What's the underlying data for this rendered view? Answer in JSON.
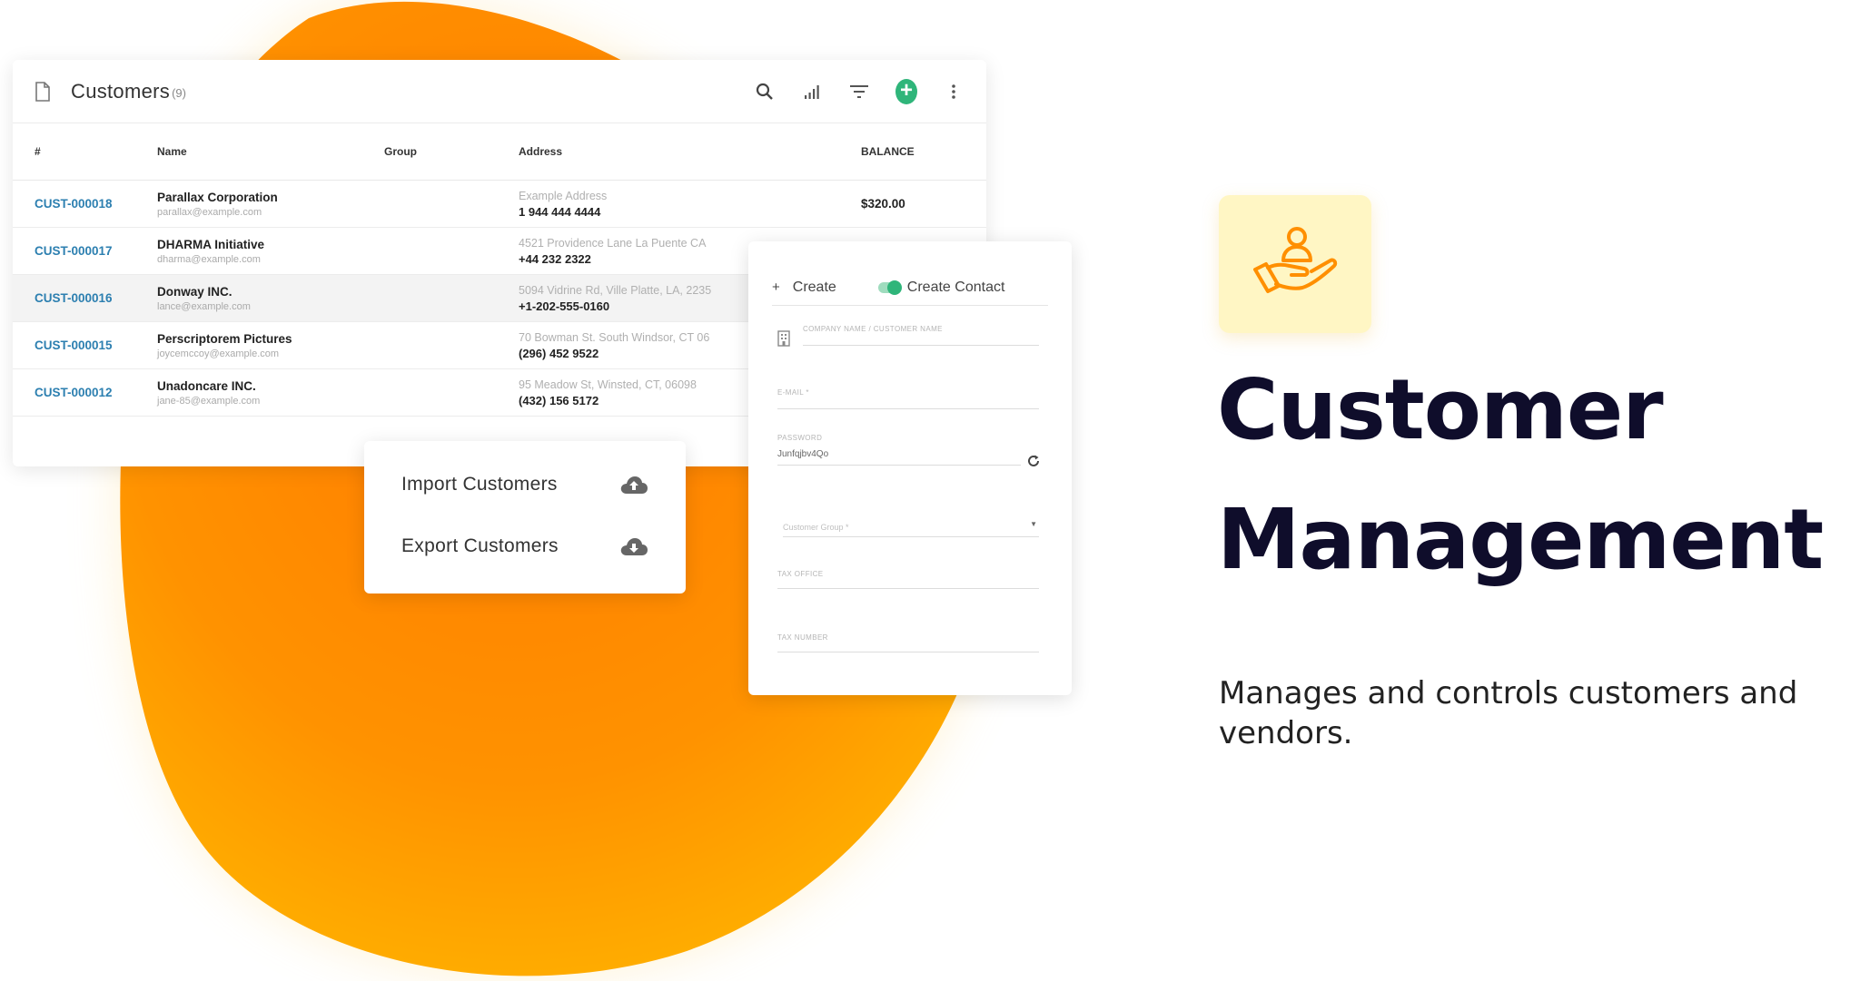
{
  "table": {
    "title": "Customers",
    "count": "(9)",
    "columns": [
      "#",
      "Name",
      "Group",
      "Address",
      "BALANCE"
    ],
    "rows": [
      {
        "id": "CUST-000018",
        "name": "Parallax Corporation",
        "email": "parallax@example.com",
        "group": "",
        "address": "Example Address",
        "phone": "1 944 444 4444",
        "balance": "$320.00"
      },
      {
        "id": "CUST-000017",
        "name": "DHARMA Initiative",
        "email": "dharma@example.com",
        "group": "",
        "address": "4521 Providence Lane La Puente CA",
        "phone": "+44 232 2322",
        "balance": ""
      },
      {
        "id": "CUST-000016",
        "name": "Donway INC.",
        "email": "lance@example.com",
        "group": "",
        "address": "5094 Vidrine Rd, Ville Platte, LA, 2235",
        "phone": "+1-202-555-0160",
        "balance": ""
      },
      {
        "id": "CUST-000015",
        "name": "Perscriptorem Pictures",
        "email": "joycemccoy@example.com",
        "group": "",
        "address": "70 Bowman St. South Windsor, CT 06",
        "phone": "(296) 452 9522",
        "balance": ""
      },
      {
        "id": "CUST-000012",
        "name": "Unadoncare INC.",
        "email": "jane-85@example.com",
        "group": "",
        "address": "95 Meadow St, Winsted, CT, 06098",
        "phone": "(432) 156 5172",
        "balance": ""
      }
    ]
  },
  "io_menu": {
    "import_label": "Import Customers",
    "export_label": "Export Customers"
  },
  "form": {
    "create_label": "Create",
    "create_contact_label": "Create Contact",
    "company_label": "COMPANY NAME / CUSTOMER NAME",
    "email_label": "E-MAIL *",
    "password_label": "PASSWORD",
    "password_value": "Junfqjbv4Qo",
    "group_placeholder": "Customer Group *",
    "tax_office_label": "TAX OFFICE",
    "tax_number_label": "TAX NUMBER"
  },
  "hero": {
    "title_line1": "Customer",
    "title_line2": "Management",
    "subtitle": "Manages and controls customers and vendors."
  },
  "icons": {
    "header": [
      "document-icon",
      "search-icon",
      "signal-bars-icon",
      "filter-icon",
      "add-icon",
      "more-vert-icon"
    ],
    "io": [
      "cloud-upload-icon",
      "cloud-download-icon"
    ],
    "form": [
      "building-icon",
      "refresh-icon",
      "dropdown-arrow-icon"
    ],
    "feature": "hand-user-icon"
  },
  "colors": {
    "accent_orange": "#ff8c00",
    "accent_yellow": "#ffb400",
    "id_link": "#2c7fb0",
    "add_green": "#2fb57a",
    "title_dark": "#0f0d2b",
    "icon_bg": "#fff6c4"
  }
}
